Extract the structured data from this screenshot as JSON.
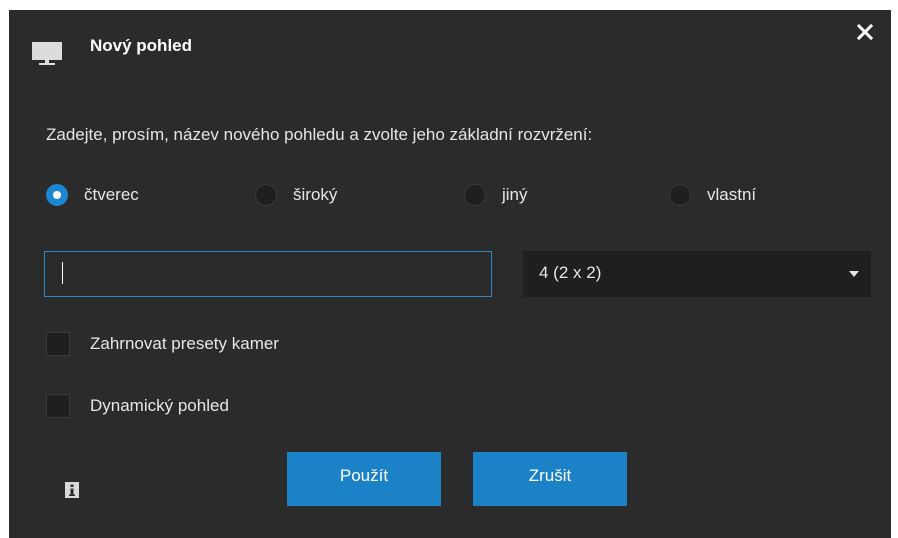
{
  "dialog": {
    "title": "Nový pohled",
    "instructions": "Zadejte, prosím, název nového pohledu a zvolte jeho základní rozvržení:",
    "layout_options": [
      {
        "label": "čtverec",
        "checked": true
      },
      {
        "label": "široký",
        "checked": false
      },
      {
        "label": "jiný",
        "checked": false
      },
      {
        "label": "vlastní",
        "checked": false
      }
    ],
    "name_input": {
      "value": "",
      "placeholder": ""
    },
    "layout_select": {
      "selected": "4 (2 x 2)"
    },
    "checkboxes": [
      {
        "label": "Zahrnovat presety kamer",
        "checked": false
      },
      {
        "label": "Dynamický pohled",
        "checked": false
      }
    ],
    "buttons": {
      "apply": "Použít",
      "cancel": "Zrušit"
    }
  },
  "icons": {
    "title": "monitor-icon",
    "close": "close-icon",
    "info": "info-icon"
  },
  "colors": {
    "background": "#2b2b2b",
    "accent": "#1c82c8",
    "input_border": "#2d86c7",
    "text": "#e6e6e6"
  }
}
